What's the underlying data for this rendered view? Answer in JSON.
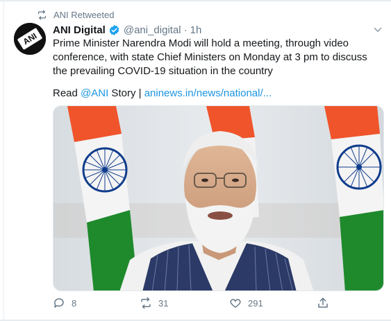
{
  "retweet": {
    "label": "ANI Retweeted"
  },
  "author": {
    "name": "ANI Digital",
    "handle": "@ani_digital",
    "separator": "·",
    "time": "1h",
    "avatar_text": "ANI"
  },
  "tweet": {
    "text": "Prime Minister Narendra Modi will hold a meeting, through video conference, with state Chief Ministers on Monday at 3 pm to discuss the prevailing COVID-19 situation in the country",
    "read_prefix": "Read ",
    "mention": "@ANI",
    "story_sep": " Story | ",
    "url": "aninews.in/news/national/..."
  },
  "actions": {
    "replies": "8",
    "retweets": "31",
    "likes": "291"
  },
  "colors": {
    "link": "#1b95e0",
    "secondary": "#657786",
    "verified": "#1da1f2",
    "saffron": "#f0542b",
    "green": "#1e8a2c",
    "chakra": "#0f3c8c"
  },
  "icons": [
    "retweet-icon",
    "verified-badge-icon",
    "chevron-down-icon",
    "reply-icon",
    "retweet-icon",
    "like-icon",
    "share-icon"
  ]
}
